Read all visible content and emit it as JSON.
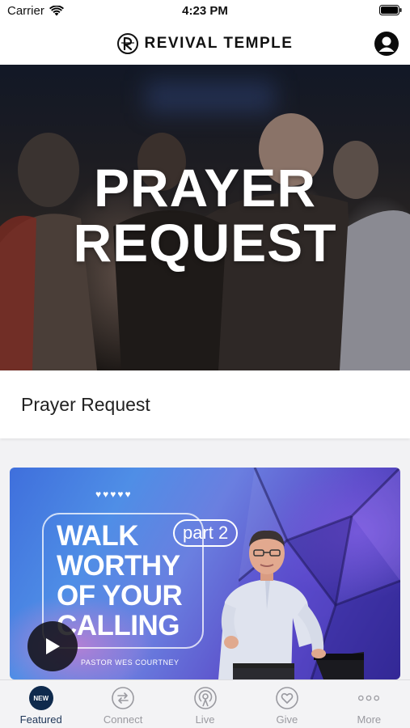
{
  "status_bar": {
    "carrier": "Carrier",
    "time": "4:23 PM"
  },
  "header": {
    "brand_name": "REVIVAL TEMPLE"
  },
  "hero": {
    "title_line1": "PRAYER",
    "title_line2": "REQUEST",
    "caption": "Prayer Request"
  },
  "sermon": {
    "hearts": "♥♥♥♥♥",
    "title_line1": "WALK",
    "title_line2": "WORTHY",
    "title_line3": "OF YOUR",
    "title_line4": "CALLING",
    "part": "part 2",
    "pastor": "PASTOR WES COURTNEY"
  },
  "tabs": [
    {
      "label": "Featured",
      "badge": "NEW",
      "icon": "new-badge-icon",
      "active": true
    },
    {
      "label": "Connect",
      "icon": "connect-icon",
      "active": false
    },
    {
      "label": "Live",
      "icon": "live-icon",
      "active": false
    },
    {
      "label": "Give",
      "icon": "give-icon",
      "active": false
    },
    {
      "label": "More",
      "icon": "more-icon",
      "active": false
    }
  ],
  "colors": {
    "accent": "#0f2a4d",
    "tab_inactive": "#9a9aa0"
  }
}
